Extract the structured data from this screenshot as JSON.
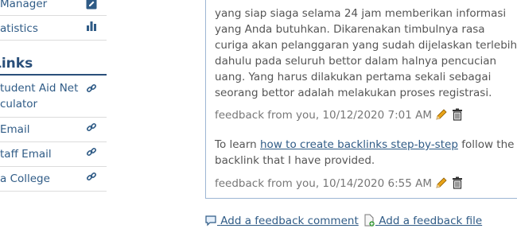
{
  "sidebar": {
    "top_items": [
      {
        "label": "Manager",
        "icon": "edit-icon"
      },
      {
        "label": "atistics",
        "icon": "bar-chart-icon"
      }
    ],
    "links_heading": "Links",
    "links": [
      {
        "label": "tudent Aid Net culator",
        "icon": "link-icon"
      },
      {
        "label": "Email",
        "icon": "link-icon"
      },
      {
        "label": "taff Email",
        "icon": "link-icon"
      },
      {
        "label": "a College",
        "icon": "link-icon"
      }
    ]
  },
  "feedback": {
    "first_body": "yang siap siaga selama 24 jam memberikan informasi yang Anda butuhkan. Dikarenakan timbulnya rasa curiga akan pelanggaran yang sudah dijelaskan terlebih dahulu pada seluruh bettor dalam halnya pencucian uang. Yang harus dilakukan pertama sekali sebagai seorang bettor adalah melakukan proses registrasi.",
    "first_meta": "feedback from you, 10/12/2020 7:01 AM",
    "second_intro": "To learn",
    "second_link": "how to create backlinks step-by-step",
    "second_rest": "follow the backlink that I have provided.",
    "second_meta": "feedback from you, 10/14/2020 6:55 AM"
  },
  "actions": {
    "add_comment": "Add a feedback comment",
    "add_file": "Add a feedback file"
  },
  "colors": {
    "link": "#2f5b86",
    "heading": "#2a4f7a",
    "panel_border": "#9db6d4",
    "text": "#555555"
  }
}
